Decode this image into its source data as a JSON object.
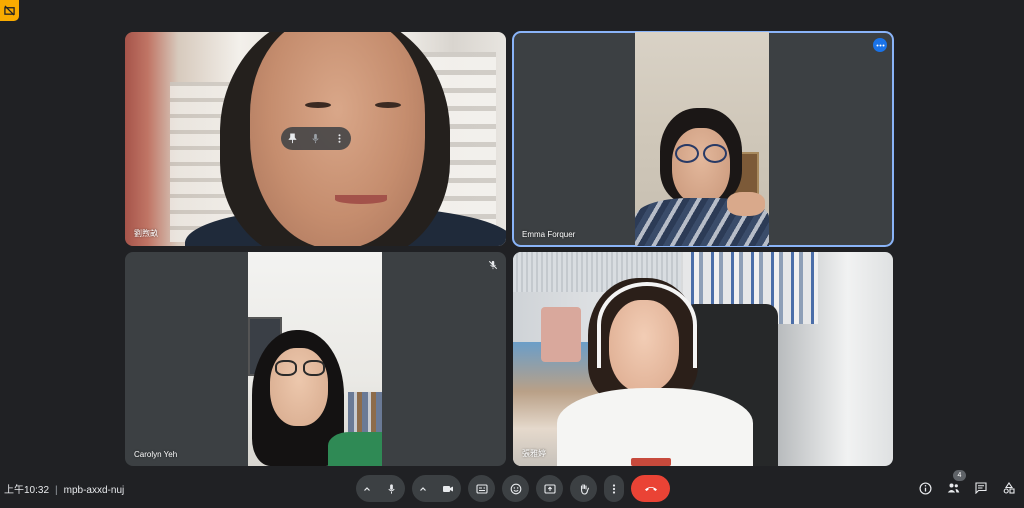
{
  "meeting": {
    "time": "上午10:32",
    "separator": "|",
    "code": "mpb-axxd-nuj"
  },
  "participants": [
    {
      "name": "劉煦畝",
      "pinned_controls": true
    },
    {
      "name": "Emma Forquer",
      "active_speaker": true
    },
    {
      "name": "Carolyn Yeh",
      "muted": true
    },
    {
      "name": "張雅婷"
    }
  ],
  "people_count": "4",
  "icons": {
    "corner": "presentation-off-icon",
    "pin": "pin-icon",
    "mic": "mic-icon",
    "camera": "camera-icon",
    "captions": "captions-icon",
    "emoji": "emoji-icon",
    "present": "present-screen-icon",
    "hand": "raise-hand-icon",
    "more": "more-vert-icon",
    "leave": "call-end-icon",
    "info": "info-icon",
    "people": "people-icon",
    "chat": "chat-icon",
    "activities": "activities-icon"
  },
  "colors": {
    "background": "#202124",
    "tile": "#3c4043",
    "active_outline": "#8ab4f8",
    "leave": "#ea4335",
    "badge": "#f9ab00"
  }
}
